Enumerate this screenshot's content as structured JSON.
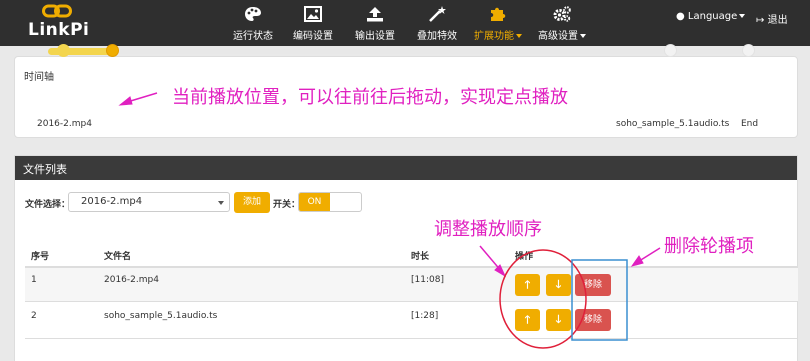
{
  "brand": {
    "name": "LinkPi"
  },
  "nav": {
    "items": [
      {
        "label": "运行状态",
        "icon": "palette-icon"
      },
      {
        "label": "编码设置",
        "icon": "image-icon"
      },
      {
        "label": "输出设置",
        "icon": "upload-icon"
      },
      {
        "label": "叠加特效",
        "icon": "magic-wand-icon"
      },
      {
        "label": "扩展功能",
        "icon": "puzzle-icon",
        "active": true,
        "dropdown": true
      },
      {
        "label": "高级设置",
        "icon": "gears-icon",
        "dropdown": true
      }
    ],
    "language_label": "Language",
    "logout_label": "退出"
  },
  "timeline": {
    "title": "时间轴",
    "start_file": "2016-2.mp4",
    "next_file": "soho_sample_5.1audio.ts",
    "end_label": "End"
  },
  "files": {
    "title": "文件列表",
    "select_label": "文件选择：",
    "selected_file": "2016-2.mp4",
    "add_label": "添加",
    "switch_label": "开关：",
    "switch_state": "ON",
    "columns": [
      "序号",
      "文件名",
      "时长",
      "操作"
    ],
    "rows": [
      {
        "index": "1",
        "name": "2016-2.mp4",
        "duration": "[11:08]",
        "up": "🡑",
        "down": "🡓",
        "delete": "移除"
      },
      {
        "index": "2",
        "name": "soho_sample_5.1audio.ts",
        "duration": "[1:28]",
        "up": "🡑",
        "down": "🡓",
        "delete": "移除"
      }
    ]
  },
  "annotations": {
    "position": "当前播放位置，可以往前往后拖动，实现定点播放",
    "order": "调整播放顺序",
    "delete": "删除轮播项"
  },
  "colors": {
    "accent": "#f0ad00",
    "danger": "#d9534f",
    "annotation": "#e020c0",
    "navbar": "#2f2f2f"
  }
}
